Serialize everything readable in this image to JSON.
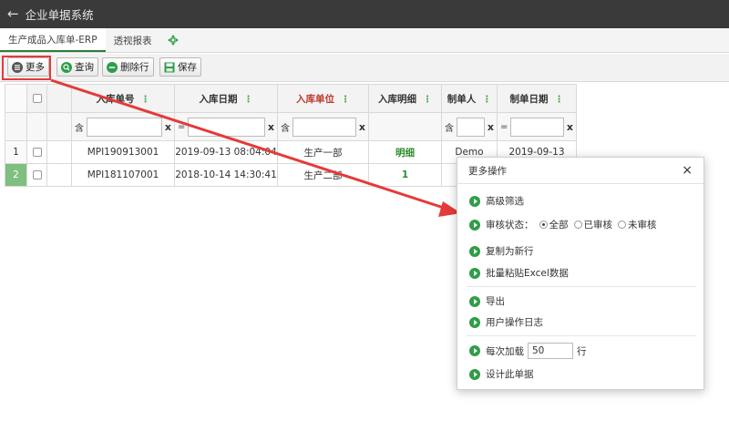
{
  "app": {
    "title": "企业单据系统"
  },
  "tabs": [
    {
      "label": "生产成品入库单-ERP",
      "active": true
    },
    {
      "label": "透视报表",
      "active": false
    }
  ],
  "toolbar": {
    "more_label": "更多",
    "query_label": "查询",
    "delete_row_label": "删除行",
    "save_label": "保存"
  },
  "grid": {
    "columns": [
      {
        "label": "入库单号",
        "red": false
      },
      {
        "label": "入库日期",
        "red": false
      },
      {
        "label": "入库单位",
        "red": true
      },
      {
        "label": "入库明细",
        "red": false
      },
      {
        "label": "制单人",
        "red": false
      },
      {
        "label": "制单日期",
        "red": false
      }
    ],
    "filters": {
      "contains_op": "含",
      "equals_op": "=",
      "clear": "x"
    },
    "rows": [
      {
        "num": "1",
        "code": "MPI190913001",
        "date": "2019-09-13 08:04:04",
        "unit": "生产一部",
        "detail": "明细",
        "maker": "Demo",
        "make_date": "2019-09-13"
      },
      {
        "num": "2",
        "code": "MPI181107001",
        "date": "2018-10-14 14:30:41",
        "unit": "生产二部",
        "detail": "1",
        "maker": "",
        "make_date": ""
      }
    ]
  },
  "dialog": {
    "title": "更多操作",
    "close": "×",
    "advanced_filter": "高级筛选",
    "audit_status_label": "审核状态：",
    "audit_options": [
      "全部",
      "已审核",
      "未审核"
    ],
    "copy_new_row": "复制为新行",
    "batch_paste": "批量粘贴Excel数据",
    "export": "导出",
    "user_log": "用户操作日志",
    "load_each_label": "每次加载",
    "load_each_value": "50",
    "load_each_unit": "行",
    "design": "设计此单据"
  },
  "colors": {
    "topbar": "#3a3a3a",
    "accent_green": "#2f9d48",
    "highlight_red": "#e53a3a"
  }
}
